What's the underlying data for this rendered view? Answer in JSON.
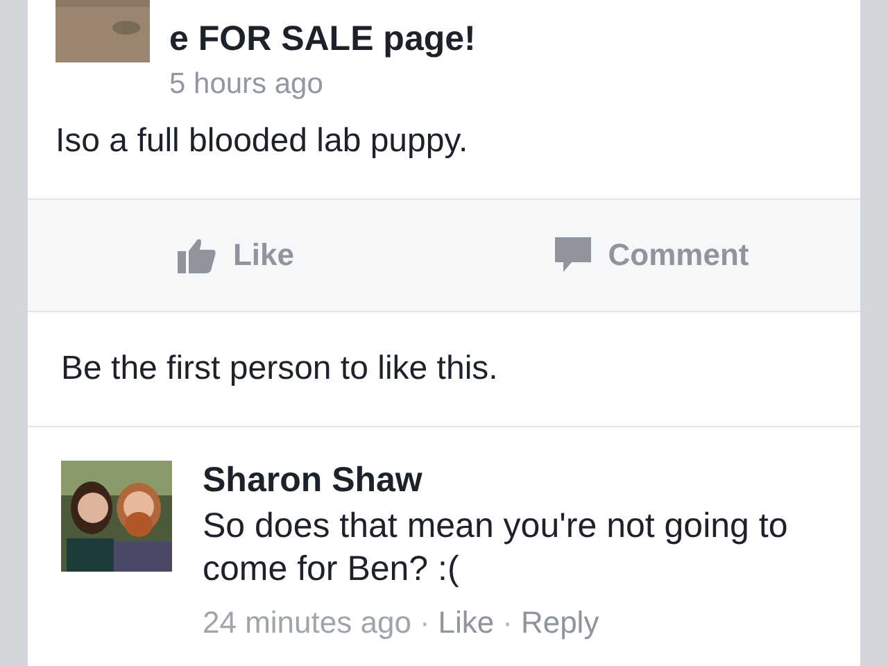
{
  "post": {
    "title": "e FOR SALE page!",
    "time": "5 hours ago",
    "text": "Iso a full blooded lab puppy."
  },
  "actions": [
    {
      "kind": "like",
      "label": "Like"
    },
    {
      "kind": "comment",
      "label": "Comment"
    }
  ],
  "likes_summary": "Be the first person to like this.",
  "comments": [
    {
      "author": "Sharon Shaw",
      "text": "So does that mean you're not going to come for Ben? :(",
      "time": "24 minutes ago",
      "links": [
        "Like",
        "Reply"
      ],
      "separator": "·"
    }
  ]
}
